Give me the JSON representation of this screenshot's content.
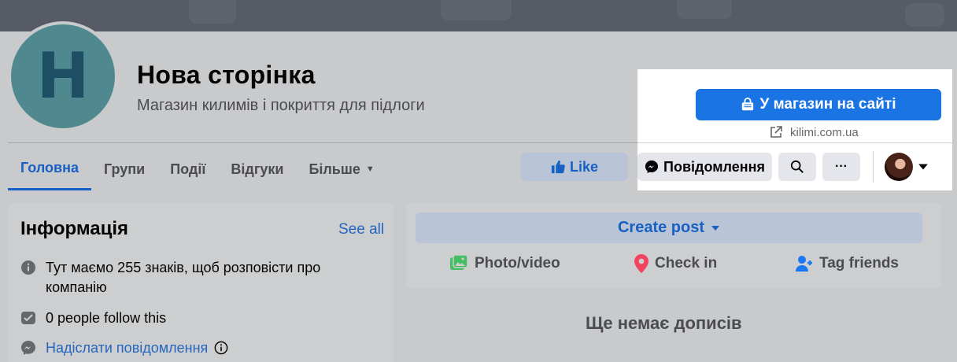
{
  "page": {
    "avatar_letter": "H",
    "title": "Нова сторінка",
    "subtitle": "Магазин килимів і покриття для підлоги"
  },
  "nav": {
    "tabs": [
      {
        "label": "Головна",
        "active": true
      },
      {
        "label": "Групи"
      },
      {
        "label": "Події"
      },
      {
        "label": "Відгуки"
      },
      {
        "label": "Більше",
        "dropdown": true
      }
    ]
  },
  "actions": {
    "like_label": "Like",
    "shop_label": "У магазин на сайті",
    "site_link": "kilimi.com.ua",
    "message_label": "Повідомлення",
    "more_glyph": "···"
  },
  "info": {
    "title": "Інформація",
    "see_all": "See all",
    "description": "Тут маємо 255 знаків, щоб розповісти про компанію",
    "followers": "0 people follow this",
    "send_message": "Надіслати повідомлення"
  },
  "posts": {
    "create_post": "Create post",
    "photo_video": "Photo/video",
    "check_in": "Check in",
    "tag_friends": "Tag friends",
    "empty": "Ще немає дописів"
  },
  "colors": {
    "accent": "#1b74e4",
    "link": "#2466c0",
    "overlay_bg": "#c9cacc",
    "highlight_bg": "#ffffff",
    "avatar_bg": "#4f898f",
    "avatar_letter": "#1e4e63"
  },
  "icons": [
    "shopping-bag-icon",
    "external-link-icon",
    "thumbs-up-icon",
    "messenger-icon",
    "search-icon",
    "more-icon",
    "chevron-down-icon",
    "info-icon",
    "followers-icon",
    "photo-icon",
    "location-pin-icon",
    "tag-friends-icon"
  ]
}
